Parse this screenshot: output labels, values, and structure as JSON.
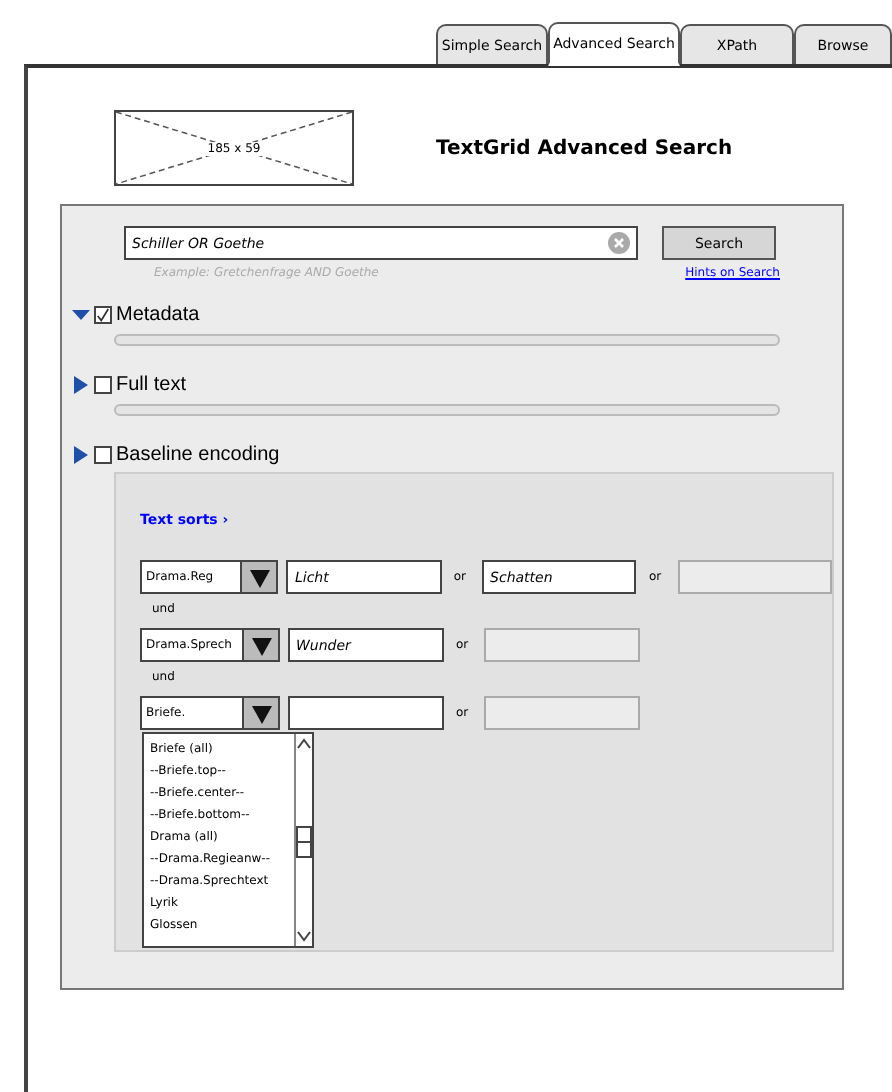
{
  "tabs": [
    {
      "label": "Simple Search",
      "selected": false
    },
    {
      "label": "Advanced Search",
      "selected": true
    },
    {
      "label": "XPath",
      "selected": false
    },
    {
      "label": "Browse",
      "selected": false
    }
  ],
  "logo": {
    "label": "185 x 59"
  },
  "title": "TextGrid Advanced Search",
  "search": {
    "value": "Schiller OR Goethe",
    "button": "Search",
    "example": "Example: Gretchenfrage AND Goethe",
    "hints_link": "Hints on Search"
  },
  "sections": [
    {
      "label": "Metadata",
      "expanded": true,
      "checked": true
    },
    {
      "label": "Full text",
      "expanded": false,
      "checked": false
    },
    {
      "label": "Baseline encoding",
      "expanded": false,
      "checked": false,
      "body": {
        "link": "Text sorts",
        "link_arrow": "›",
        "rows": [
          {
            "select": "Drama.Reg",
            "terms": [
              {
                "value": "Licht",
                "disabled": false
              },
              {
                "value": "Schatten",
                "disabled": false
              },
              {
                "disabled": true
              }
            ],
            "or": [
              "or",
              "or"
            ],
            "connector": "und"
          },
          {
            "select": "Drama.Sprech",
            "terms": [
              {
                "value": "Wunder",
                "disabled": false
              },
              {
                "disabled": true
              }
            ],
            "or": [
              "or"
            ],
            "connector": "und"
          },
          {
            "select": "Briefe.",
            "terms": [
              {
                "disabled": false
              },
              {
                "disabled": true
              }
            ],
            "or": [
              "or"
            ],
            "open": true
          }
        ],
        "options": [
          "Briefe (all)",
          "--Briefe.top--",
          "--Briefe.center--",
          "--Briefe.bottom--",
          "Drama (all)",
          "--Drama.Regieanw--",
          "--Drama.Sprechtext",
          "Lyrik",
          "Glossen"
        ]
      }
    }
  ]
}
